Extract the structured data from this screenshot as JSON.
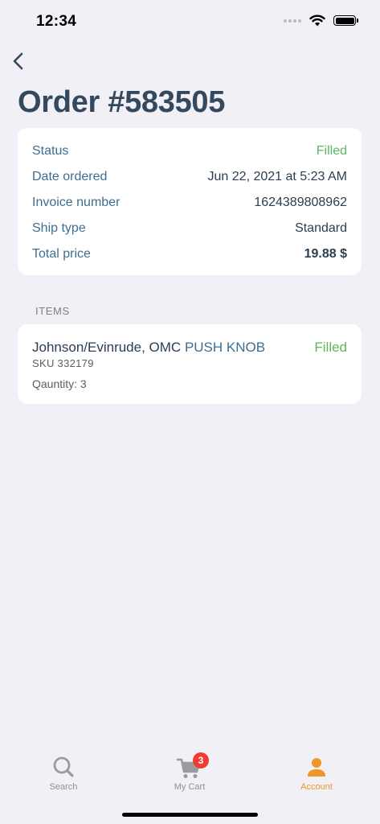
{
  "status_bar": {
    "time": "12:34"
  },
  "header": {
    "title": "Order #583505"
  },
  "details": [
    {
      "label": "Status",
      "value": "Filled",
      "style": "green"
    },
    {
      "label": "Date ordered",
      "value": "Jun 22, 2021 at 5:23 AM",
      "style": "normal"
    },
    {
      "label": "Invoice number",
      "value": "1624389808962",
      "style": "normal"
    },
    {
      "label": "Ship type",
      "value": "Standard",
      "style": "normal"
    },
    {
      "label": "Total price",
      "value": "19.88 $",
      "style": "bold"
    }
  ],
  "items_section": {
    "label": "ITEMS"
  },
  "items": [
    {
      "brand": "Johnson/Evinrude, OMC",
      "part": "PUSH KNOB",
      "status": "Filled",
      "sku": "SKU 332179",
      "quantity": "Qauntity: 3"
    }
  ],
  "tabs": [
    {
      "label": "Search",
      "icon": "search-icon"
    },
    {
      "label": "My Cart",
      "icon": "cart-icon",
      "badge": "3"
    },
    {
      "label": "Account",
      "icon": "user-icon",
      "active": true
    }
  ],
  "colors": {
    "accent": "#f0952a",
    "green": "#5cb85c",
    "link": "#3c6e91",
    "badge": "#ef3b30"
  }
}
